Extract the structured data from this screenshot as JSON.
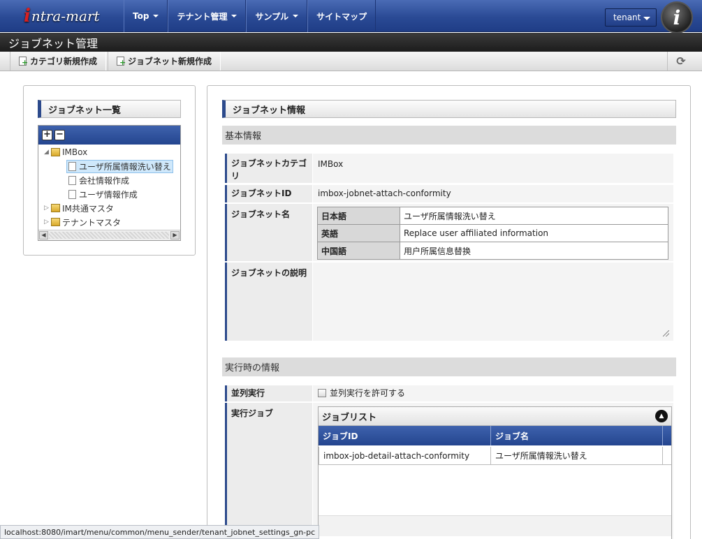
{
  "header": {
    "logo": {
      "mark": "i",
      "text": "ntra-mart"
    },
    "nav": [
      {
        "label": "Top"
      },
      {
        "label": "テナント管理"
      },
      {
        "label": "サンプル"
      },
      {
        "label": "サイトマップ"
      }
    ],
    "tenant": "tenant",
    "user_badge": "i"
  },
  "page_title": "ジョブネット管理",
  "toolbar": {
    "new_category": "カテゴリ新規作成",
    "new_jobnet": "ジョブネット新規作成"
  },
  "left": {
    "title": "ジョブネット一覧",
    "tree": {
      "expand": "+",
      "collapse": "−",
      "items": [
        {
          "label": "IMBox",
          "type": "folder",
          "toggle": "◢"
        },
        {
          "label": "ユーザ所属情報洗い替え",
          "type": "file"
        },
        {
          "label": "会社情報作成",
          "type": "file"
        },
        {
          "label": "ユーザ情報作成",
          "type": "file"
        },
        {
          "label": "IM共通マスタ",
          "type": "folder",
          "toggle": "▷"
        },
        {
          "label": "テナントマスタ",
          "type": "folder",
          "toggle": "▷"
        }
      ]
    }
  },
  "right": {
    "title": "ジョブネット情報",
    "basic_section": "基本情報",
    "fields": {
      "category_label": "ジョブネットカテゴリ",
      "category_value": "IMBox",
      "id_label": "ジョブネットID",
      "id_value": "imbox-jobnet-attach-conformity",
      "name_label": "ジョブネット名",
      "names": [
        {
          "lang": "日本語",
          "value": "ユーザ所属情報洗い替え"
        },
        {
          "lang": "英語",
          "value": "Replace user affiliated information"
        },
        {
          "lang": "中国語",
          "value": "用户所属信息替换"
        }
      ],
      "desc_label": "ジョブネットの説明",
      "desc_value": ""
    },
    "runtime_section": "実行時の情報",
    "parallel_label": "並列実行",
    "parallel_checkbox": "並列実行を許可する",
    "exec_job_label": "実行ジョブ",
    "joblist": {
      "title": "ジョブリスト",
      "columns": [
        "ジョブID",
        "ジョブ名"
      ],
      "rows": [
        {
          "id": "imbox-job-detail-attach-conformity",
          "name": "ユーザ所属情報洗い替え"
        }
      ]
    }
  },
  "status_url": "localhost:8080/imart/menu/common/menu_sender/tenant_jobnet_settings_gn-pc"
}
